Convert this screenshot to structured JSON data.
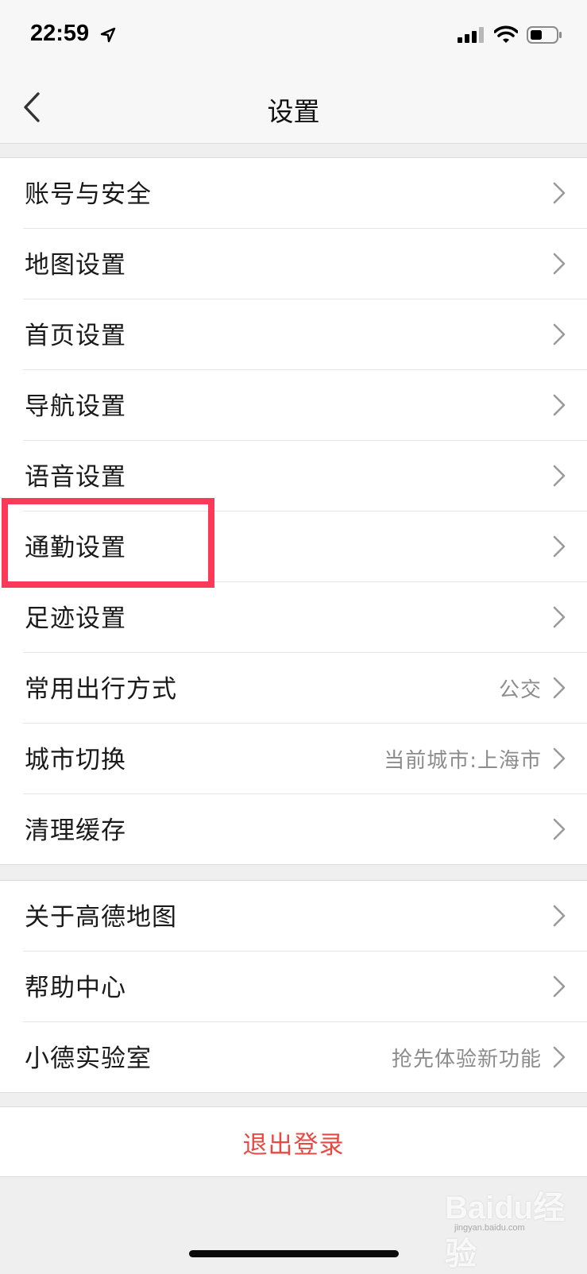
{
  "status_bar": {
    "time": "22:59",
    "icons": [
      "location-arrow-icon",
      "cellular-signal-icon",
      "wifi-icon",
      "battery-icon"
    ]
  },
  "nav": {
    "title": "设置",
    "back_icon": "chevron-left-icon"
  },
  "groups": [
    {
      "items": [
        {
          "label": "账号与安全",
          "value": ""
        },
        {
          "label": "地图设置",
          "value": ""
        },
        {
          "label": "首页设置",
          "value": ""
        },
        {
          "label": "导航设置",
          "value": ""
        },
        {
          "label": "语音设置",
          "value": ""
        },
        {
          "label": "通勤设置",
          "value": ""
        },
        {
          "label": "足迹设置",
          "value": ""
        },
        {
          "label": "常用出行方式",
          "value": "公交"
        },
        {
          "label": "城市切换",
          "value": "当前城市:上海市"
        },
        {
          "label": "清理缓存",
          "value": ""
        }
      ]
    },
    {
      "items": [
        {
          "label": "关于高德地图",
          "value": ""
        },
        {
          "label": "帮助中心",
          "value": ""
        },
        {
          "label": "小德实验室",
          "value": "抢先体验新功能"
        }
      ]
    }
  ],
  "logout": {
    "label": "退出登录"
  },
  "watermark": {
    "main": "Baidu经验",
    "sub": "jingyan.baidu.com"
  },
  "colors": {
    "logout": "#e44b45",
    "highlight": "#fb3a5a",
    "background": "#efefef"
  }
}
